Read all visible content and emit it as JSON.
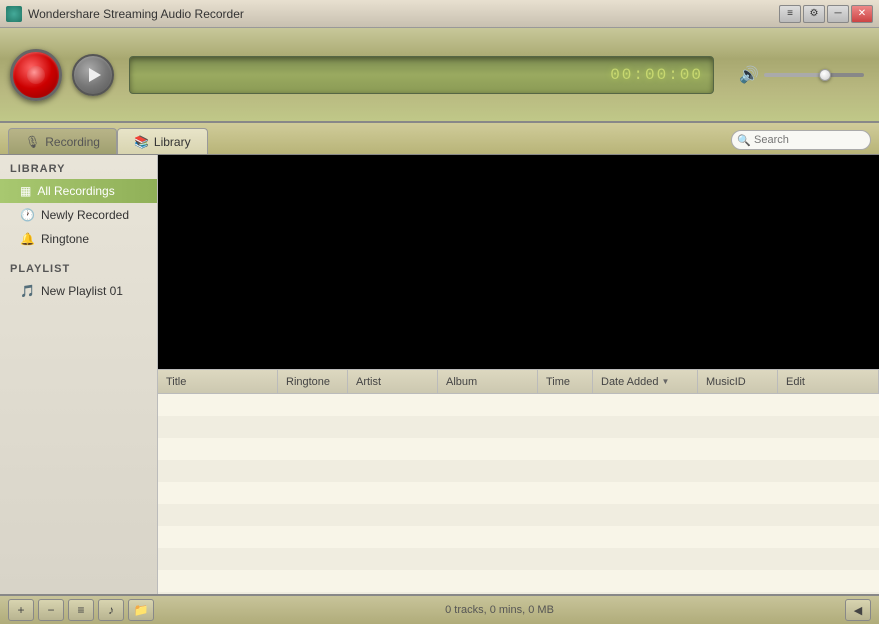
{
  "app": {
    "title": "Wondershare Streaming Audio Recorder",
    "icon": "audio-recorder-icon"
  },
  "titlebar": {
    "minimize_label": "─",
    "maximize_label": "□",
    "close_label": "✕",
    "settings_label": "⚙",
    "menu_label": "≡"
  },
  "toolbar": {
    "timer": "00:00:00",
    "volume_level": 60
  },
  "tabs": {
    "recording_label": "Recording",
    "library_label": "Library"
  },
  "search": {
    "placeholder": "Search"
  },
  "sidebar": {
    "library_header": "LIBRARY",
    "playlist_header": "PLAYLIST",
    "items": [
      {
        "id": "all-recordings",
        "label": "All Recordings",
        "icon": "grid-icon"
      },
      {
        "id": "newly-recorded",
        "label": "Newly Recorded",
        "icon": "clock-icon"
      },
      {
        "id": "ringtone",
        "label": "Ringtone",
        "icon": "bell-icon"
      }
    ],
    "playlists": [
      {
        "id": "new-playlist-01",
        "label": "New Playlist 01",
        "icon": "music-icon"
      }
    ]
  },
  "table": {
    "columns": [
      {
        "id": "title",
        "label": "Title"
      },
      {
        "id": "ringtone",
        "label": "Ringtone"
      },
      {
        "id": "artist",
        "label": "Artist"
      },
      {
        "id": "album",
        "label": "Album"
      },
      {
        "id": "time",
        "label": "Time"
      },
      {
        "id": "date-added",
        "label": "Date Added"
      },
      {
        "id": "musicid",
        "label": "MusicID"
      },
      {
        "id": "edit",
        "label": "Edit"
      }
    ],
    "rows": []
  },
  "statusbar": {
    "status_text": "0 tracks, 0 mins, 0 MB"
  },
  "bottom_buttons": {
    "add_label": "+",
    "remove_label": "−",
    "filter_label": "≡",
    "convert_label": "♪",
    "folder_label": "📁",
    "back_label": "◀"
  }
}
